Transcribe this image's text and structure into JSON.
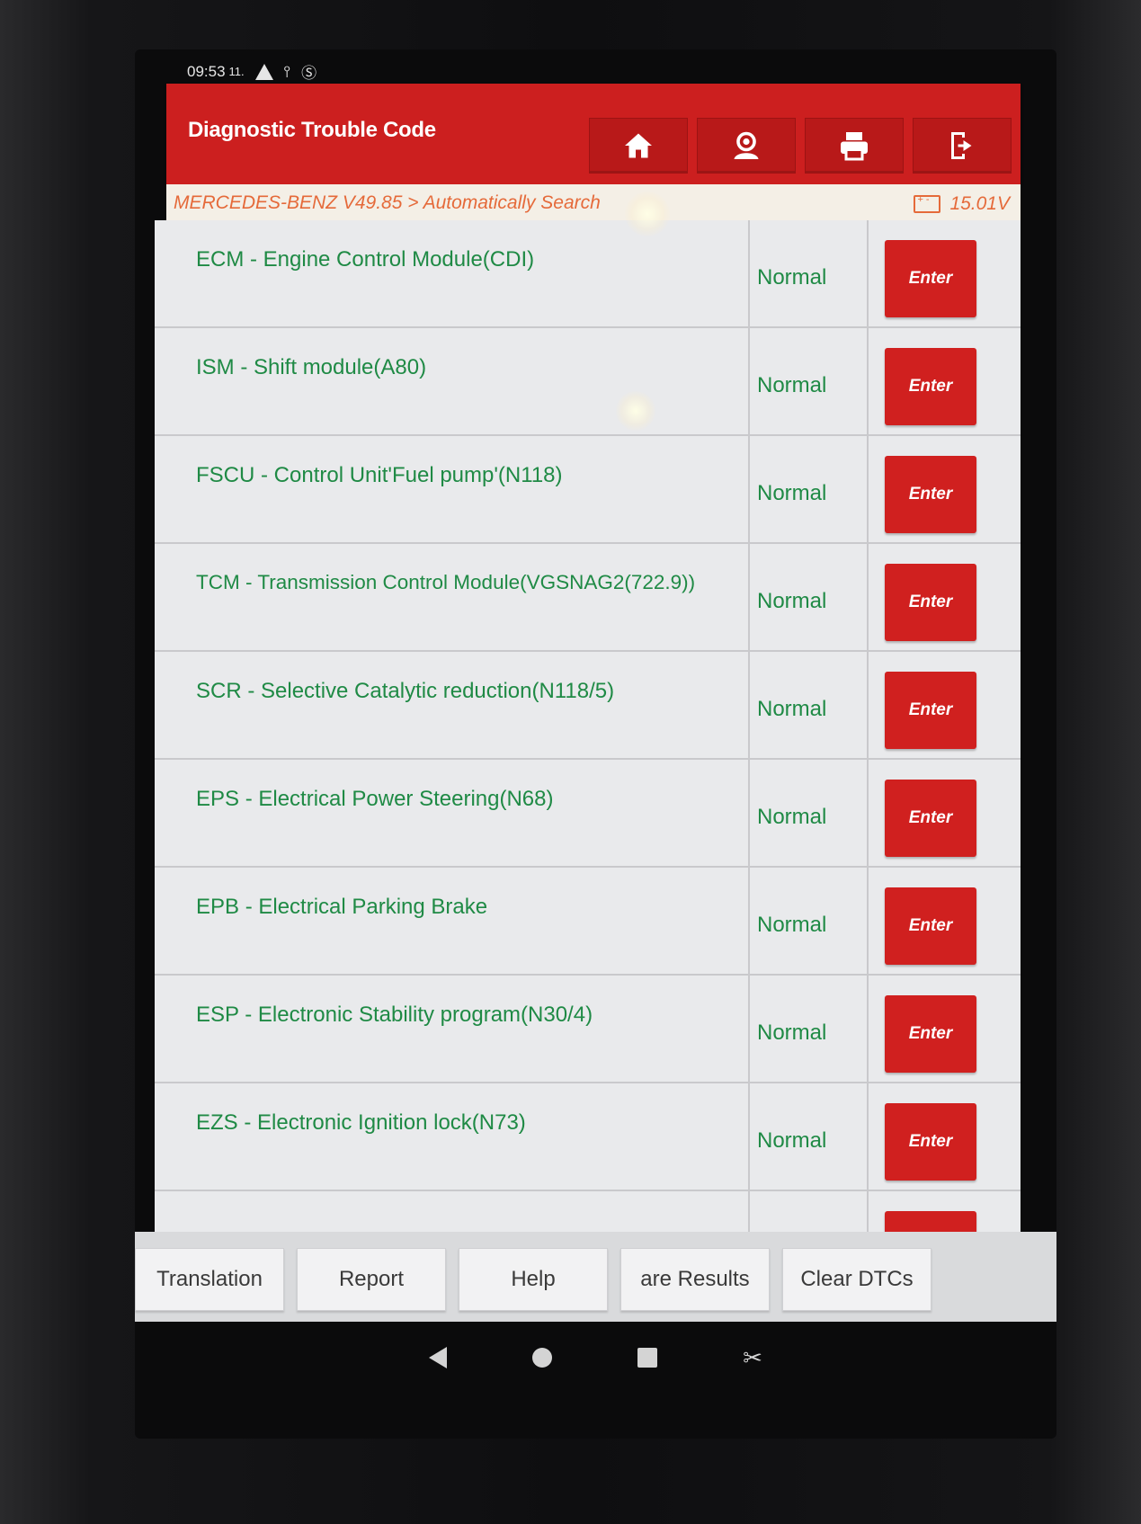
{
  "status_bar": {
    "time": "09:53",
    "carrier": "11.",
    "icons": [
      "warning-icon",
      "usb-icon",
      "nfc-icon",
      "bluetooth-icon",
      "battery-icon"
    ]
  },
  "header": {
    "title": "Diagnostic Trouble Code",
    "toolbar": [
      "home-icon",
      "user-icon",
      "print-icon",
      "exit-icon"
    ],
    "accent_color": "#cc1f1f"
  },
  "breadcrumb": {
    "path": "MERCEDES-BENZ V49.85 > Automatically Search",
    "voltage": "15.01V"
  },
  "modules": [
    {
      "name": "ECM - Engine Control Module(CDI)",
      "status": "Normal",
      "action": "Enter"
    },
    {
      "name": "ISM - Shift module(A80)",
      "status": "Normal",
      "action": "Enter"
    },
    {
      "name": "FSCU - Control Unit'Fuel pump'(N118)",
      "status": "Normal",
      "action": "Enter"
    },
    {
      "name": "TCM - Transmission Control Module(VGSNAG2(722.9))",
      "status": "Normal",
      "action": "Enter"
    },
    {
      "name": "SCR - Selective Catalytic reduction(N118/5)",
      "status": "Normal",
      "action": "Enter"
    },
    {
      "name": "EPS - Electrical Power Steering(N68)",
      "status": "Normal",
      "action": "Enter"
    },
    {
      "name": "EPB - Electrical Parking Brake",
      "status": "Normal",
      "action": "Enter"
    },
    {
      "name": "ESP - Electronic Stability program(N30/4)",
      "status": "Normal",
      "action": "Enter"
    },
    {
      "name": "EZS - Electronic Ignition lock(N73)",
      "status": "Normal",
      "action": "Enter"
    }
  ],
  "bottom_buttons": [
    "Translation",
    "Report",
    "Help",
    "are Results",
    "Clear DTCs"
  ],
  "colors": {
    "module_text": "#1f8a45",
    "enter_button": "#d0201f",
    "breadcrumb_text": "#e56a3a"
  }
}
